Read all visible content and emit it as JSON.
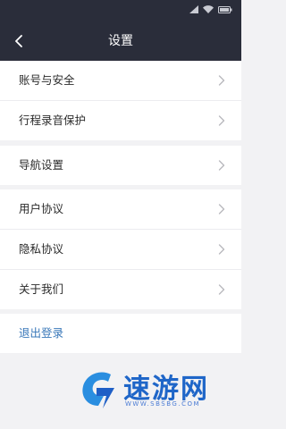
{
  "nav": {
    "title": "设置"
  },
  "items": [
    {
      "label": "账号与安全"
    },
    {
      "label": "行程录音保护"
    },
    {
      "label": "导航设置"
    },
    {
      "label": "用户协议"
    },
    {
      "label": "隐私协议"
    },
    {
      "label": "关于我们"
    }
  ],
  "logout": {
    "label": "退出登录"
  },
  "watermark": {
    "brand": "速游网",
    "url": "WWW.SBSBG.COM"
  },
  "colors": {
    "header": "#2a2d3a",
    "background": "#f2f2f4",
    "link": "#3a78b9",
    "brand": "#1f66c8"
  },
  "icons": {
    "back": "chevron-left-icon",
    "row": "chevron-right-icon",
    "signal": "signal-icon",
    "wifi": "wifi-icon",
    "battery": "battery-icon"
  }
}
